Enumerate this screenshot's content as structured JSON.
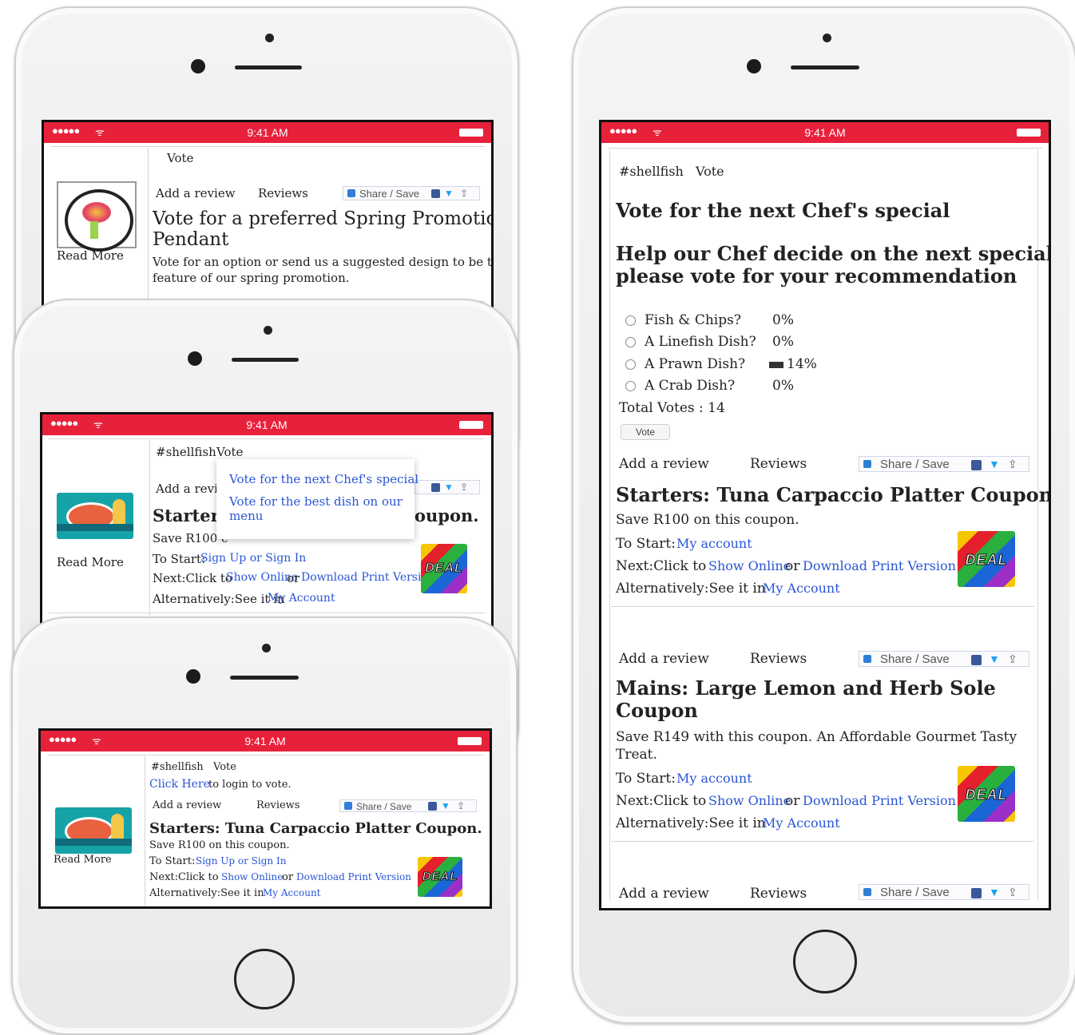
{
  "status_bar": {
    "signal": "●●●●●",
    "wifi": "ᯤ",
    "time": "9:41 AM"
  },
  "common": {
    "read_more": "Read More",
    "vote_tab": "Vote",
    "hashtag": "#shellfish",
    "add_review": "Add a review",
    "reviews": "Reviews",
    "share_save": "Share / Save",
    "deal": "DEAL",
    "to_start": "To Start:",
    "sign_up_or_sign_in": "Sign Up or Sign In",
    "my_account_lower": "My account",
    "next_click_to": "Next:Click to",
    "show_online": "Show Online",
    "or": "or",
    "download_print": "Download Print Version",
    "alternatively": "Alternatively:See it in",
    "my_account": "My Account"
  },
  "phone1": {
    "title": "Vote for a preferred Spring Promotion Pendant",
    "title_line1": "Vote for a preferred Spring Promotion",
    "title_line2": "Pendant",
    "desc_line1": "Vote for an option or send us a suggested design to be the",
    "desc_line2": "feature of our spring promotion."
  },
  "phone2": {
    "menu_items": [
      "Vote for the next Chef's special",
      "Vote for the best dish on our",
      "menu"
    ],
    "title_visible_left": "Starters:",
    "title_visible_right": "oupon.",
    "save_partial": "Save R100 c",
    "add_review_partial": "Add a revie"
  },
  "phone3": {
    "click_here": "Click Here",
    "login_text": "to login to vote.",
    "title": "Starters: Tuna Carpaccio Platter Coupon.",
    "save": "Save R100 on this coupon."
  },
  "phone4": {
    "heading1": "Vote for the next Chef's special",
    "heading2_line1": "Help our Chef decide on the next special -",
    "heading2_line2": "please vote for your recommendation",
    "poll_options": [
      {
        "label": "Fish & Chips?",
        "percent": "0%",
        "value": 0
      },
      {
        "label": "A Linefish Dish?",
        "percent": "0%",
        "value": 0
      },
      {
        "label": "A Prawn Dish?",
        "percent": "14%",
        "value": 14
      },
      {
        "label": "A Crab Dish?",
        "percent": "0%",
        "value": 0
      }
    ],
    "total_votes": "Total Votes  : 14",
    "vote_button": "Vote",
    "coupon1": {
      "title": "Starters: Tuna Carpaccio Platter Coupon.",
      "save": "Save R100 on this coupon."
    },
    "coupon2": {
      "title_line1": "Mains: Large Lemon and Herb Sole",
      "title_line2": "Coupon",
      "save_line1": "Save R149 with this coupon. An Affordable Gourmet Tasty",
      "save_line2": "Treat."
    }
  }
}
